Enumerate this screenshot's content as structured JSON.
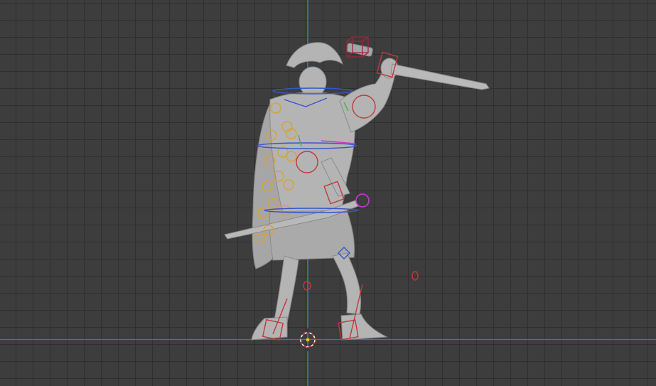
{
  "viewport": {
    "view": "front-orthographic",
    "background_color": "#3d3d3d",
    "grid_color": "#2f2f2f",
    "x_axis_color": "#b9484c",
    "z_axis_color": "#4f86c6"
  },
  "scene": {
    "model": "roman-centurion-figure",
    "mesh_color": "#b4b4b4",
    "rig": {
      "controller_colors": {
        "torso_fk": "#d5a33a",
        "ik_red": "#c0393b",
        "spine_blue": "#3a55c8",
        "magenta": "#c23bd0",
        "green": "#3cb54a"
      }
    },
    "icons": [
      "3d-cursor-icon",
      "world-origin-icon"
    ]
  }
}
